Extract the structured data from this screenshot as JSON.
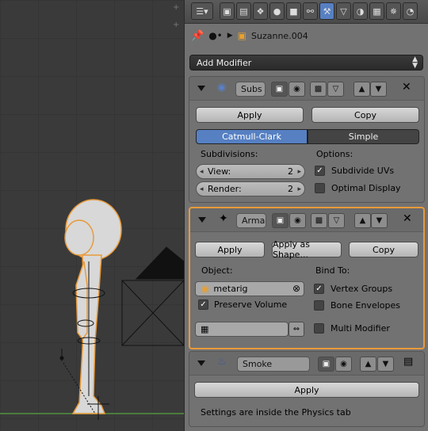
{
  "header": {
    "editor_type_icon": "properties-editor-icon",
    "context_tabs": [
      {
        "name": "render-tab",
        "glyph": "▣"
      },
      {
        "name": "render-layers-tab",
        "glyph": "▤"
      },
      {
        "name": "scene-tab",
        "glyph": "❖"
      },
      {
        "name": "world-tab",
        "glyph": "●"
      },
      {
        "name": "object-tab",
        "glyph": "■"
      },
      {
        "name": "constraints-tab",
        "glyph": "⚯"
      },
      {
        "name": "modifiers-tab",
        "glyph": "⚒"
      },
      {
        "name": "data-tab",
        "glyph": "▽"
      },
      {
        "name": "material-tab",
        "glyph": "◑"
      },
      {
        "name": "texture-tab",
        "glyph": "▦"
      },
      {
        "name": "particles-tab",
        "glyph": "✵"
      },
      {
        "name": "physics-tab",
        "glyph": "◔"
      }
    ],
    "active_tab": "modifiers-tab"
  },
  "breadcrumb": {
    "object_name": "Suzanne.004"
  },
  "add_modifier": {
    "label": "Add Modifier"
  },
  "modifiers": {
    "subsurf": {
      "name": "Subs",
      "apply": "Apply",
      "copy": "Copy",
      "type_options": [
        "Catmull-Clark",
        "Simple"
      ],
      "type_selected": "Catmull-Clark",
      "subdivisions_label": "Subdivisions:",
      "view_label": "View:",
      "view_value": "2",
      "render_label": "Render:",
      "render_value": "2",
      "options_label": "Options:",
      "subdivide_uvs": "Subdivide UVs",
      "subdivide_uvs_checked": true,
      "optimal_display": "Optimal Display",
      "optimal_display_checked": false
    },
    "armature": {
      "name": "Arma",
      "apply": "Apply",
      "apply_as_shape": "Apply as Shape...",
      "copy": "Copy",
      "object_label": "Object:",
      "object_value": "metarig",
      "preserve_volume": "Preserve Volume",
      "preserve_volume_checked": true,
      "bind_to_label": "Bind To:",
      "vertex_groups": "Vertex Groups",
      "vertex_groups_checked": true,
      "bone_envelopes": "Bone Envelopes",
      "bone_envelopes_checked": false,
      "multi_modifier": "Multi Modifier",
      "multi_modifier_checked": false,
      "vertex_group_value": ""
    },
    "smoke": {
      "name": "Smoke",
      "apply": "Apply",
      "info": "Settings are inside the Physics tab"
    }
  },
  "colors": {
    "accent_blue": "#5680c2",
    "selected_outline": "#e89a3a",
    "panel_bg": "#727272",
    "viewport_bg": "#3a3a3a"
  }
}
